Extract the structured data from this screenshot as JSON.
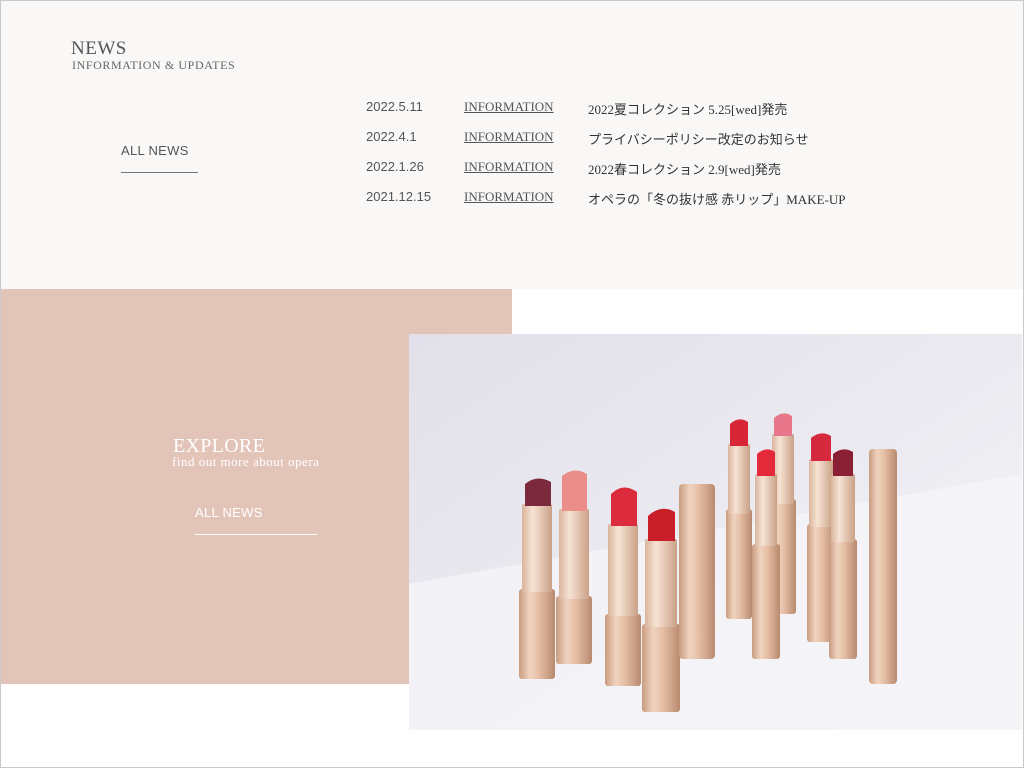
{
  "news": {
    "title": "NEWS",
    "subtitle": "INFORMATION & UPDATES",
    "all_news_label": "ALL NEWS",
    "items": [
      {
        "date": "2022.5.11",
        "category": "INFORMATION",
        "text": "2022夏コレクション 5.25[wed]発売"
      },
      {
        "date": "2022.4.1",
        "category": "INFORMATION",
        "text": "プライバシーポリシー改定のお知らせ"
      },
      {
        "date": "2022.1.26",
        "category": "INFORMATION",
        "text": "2022春コレクション 2.9[wed]発売"
      },
      {
        "date": "2021.12.15",
        "category": "INFORMATION",
        "text": "オペラの「冬の抜け感 赤リップ」MAKE-UP"
      }
    ]
  },
  "explore": {
    "title": "EXPLORE",
    "subtitle": "find out more about opera",
    "all_news_label": "ALL NEWS"
  },
  "colors": {
    "news_background": "#faf8f6",
    "explore_panel": "#e3c4b9",
    "photo_background": "#eceaf1"
  },
  "photo": {
    "subject": "lipstick-lineup-photo"
  }
}
